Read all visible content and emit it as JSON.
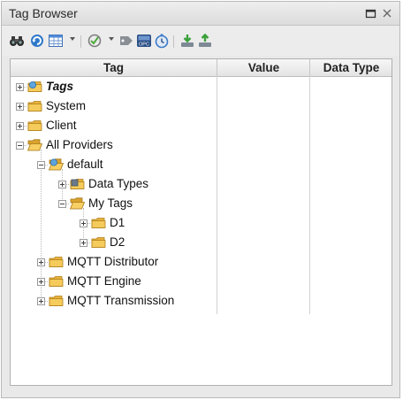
{
  "window": {
    "title": "Tag Browser"
  },
  "toolbar": {
    "tools": [
      "binoculars-icon",
      "refresh-tags-icon",
      "grid-view-icon",
      "filter-icon",
      "new-tag-icon",
      "opc-icon",
      "clock-icon",
      "import-icon",
      "export-icon"
    ]
  },
  "columns": {
    "tag": "Tag",
    "value": "Value",
    "data_type": "Data Type"
  },
  "tree": [
    {
      "label": "Tags",
      "depth": 0,
      "expanded": false,
      "bold": true,
      "folder": "refresh"
    },
    {
      "label": "System",
      "depth": 0,
      "expanded": false,
      "bold": false,
      "folder": "plain"
    },
    {
      "label": "Client",
      "depth": 0,
      "expanded": false,
      "bold": false,
      "folder": "plain"
    },
    {
      "label": "All Providers",
      "depth": 0,
      "expanded": true,
      "bold": false,
      "folder": "open"
    },
    {
      "label": "default",
      "depth": 1,
      "expanded": true,
      "bold": false,
      "folder": "refresh-open"
    },
    {
      "label": "Data Types",
      "depth": 2,
      "expanded": false,
      "bold": false,
      "folder": "datatype"
    },
    {
      "label": "My Tags",
      "depth": 2,
      "expanded": true,
      "bold": false,
      "folder": "open"
    },
    {
      "label": "D1",
      "depth": 3,
      "expanded": false,
      "bold": false,
      "folder": "plain"
    },
    {
      "label": "D2",
      "depth": 3,
      "expanded": false,
      "bold": false,
      "folder": "plain"
    },
    {
      "label": "MQTT Distributor",
      "depth": 1,
      "expanded": false,
      "bold": false,
      "folder": "plain"
    },
    {
      "label": "MQTT Engine",
      "depth": 1,
      "expanded": false,
      "bold": false,
      "folder": "plain"
    },
    {
      "label": "MQTT Transmission",
      "depth": 1,
      "expanded": false,
      "bold": false,
      "folder": "plain"
    }
  ]
}
